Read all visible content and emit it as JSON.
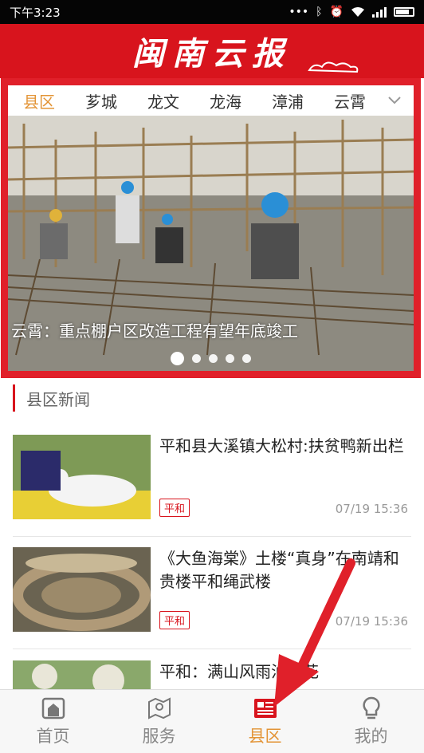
{
  "status_bar": {
    "time": "下午3:23",
    "icons": [
      "dots-icon",
      "bluetooth-icon",
      "alarm-icon",
      "wifi-icon",
      "signal-icon",
      "battery-icon"
    ]
  },
  "header": {
    "title": "闽南云报"
  },
  "tabs": {
    "items": [
      "县区",
      "芗城",
      "龙文",
      "龙海",
      "漳浦",
      "云霄"
    ],
    "active_index": 0
  },
  "banner": {
    "caption": "云霄：重点棚户区改造工程有望年底竣工",
    "dot_count": 5,
    "active_dot": 0
  },
  "section": {
    "title": "县区新闻"
  },
  "news": [
    {
      "title": "平和县大溪镇大松村:扶贫鸭新出栏",
      "tag": "平和",
      "time": "07/19 15:36"
    },
    {
      "title": "《大鱼海棠》土楼“真身”在南靖和贵楼平和绳武楼",
      "tag": "平和",
      "time": "07/19 15:36"
    },
    {
      "title": "平和：满山风雨油桐花"
    }
  ],
  "bottom_nav": {
    "items": [
      {
        "label": "首页",
        "icon": "home-icon"
      },
      {
        "label": "服务",
        "icon": "map-service-icon"
      },
      {
        "label": "县区",
        "icon": "newspaper-icon"
      },
      {
        "label": "我的",
        "icon": "lightbulb-icon"
      }
    ],
    "active_index": 2
  },
  "colors": {
    "brand_red": "#d8141d",
    "accent_orange": "#e39436",
    "annotation_red": "#e0202a"
  }
}
